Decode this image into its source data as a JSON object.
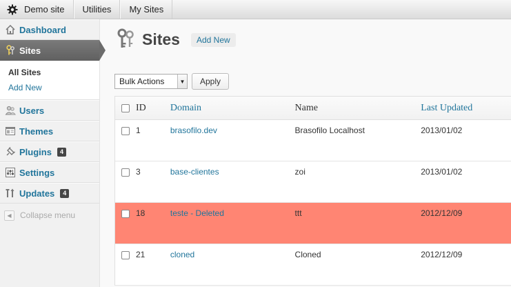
{
  "adminbar": {
    "site": "Demo site",
    "utilities": "Utilities",
    "my_sites": "My Sites"
  },
  "sidebar": {
    "items": [
      {
        "label": "Dashboard",
        "icon": "house-icon"
      },
      {
        "label": "Sites",
        "icon": "keys-icon",
        "current": true
      },
      {
        "label": "Users",
        "icon": "users-icon"
      },
      {
        "label": "Themes",
        "icon": "themes-icon"
      },
      {
        "label": "Plugins",
        "icon": "plugin-icon",
        "badge": "4"
      },
      {
        "label": "Settings",
        "icon": "settings-icon"
      },
      {
        "label": "Updates",
        "icon": "updates-icon",
        "badge": "4"
      }
    ],
    "submenu": [
      {
        "label": "All Sites",
        "active": true
      },
      {
        "label": "Add New"
      }
    ],
    "collapse": "Collapse menu"
  },
  "page": {
    "title": "Sites",
    "add_new": "Add New"
  },
  "bulk": {
    "select": "Bulk Actions",
    "apply": "Apply"
  },
  "table": {
    "headers": {
      "id": "ID",
      "domain": "Domain",
      "name": "Name",
      "updated": "Last Updated"
    },
    "rows": [
      {
        "id": "1",
        "domain": "brasofilo.dev",
        "name": "Brasofilo Localhost",
        "updated": "2013/01/02"
      },
      {
        "id": "3",
        "domain": "base-clientes",
        "name": "zoi",
        "updated": "2013/01/02"
      },
      {
        "id": "18",
        "domain": "teste - Deleted",
        "name": "ttt",
        "updated": "2012/12/09",
        "deleted": true
      },
      {
        "id": "21",
        "domain": "cloned",
        "name": "Cloned",
        "updated": "2012/12/09"
      }
    ]
  },
  "colors": {
    "link": "#21759b",
    "deleted_row": "#ff8573",
    "current_menu": "#6c6c6c"
  }
}
